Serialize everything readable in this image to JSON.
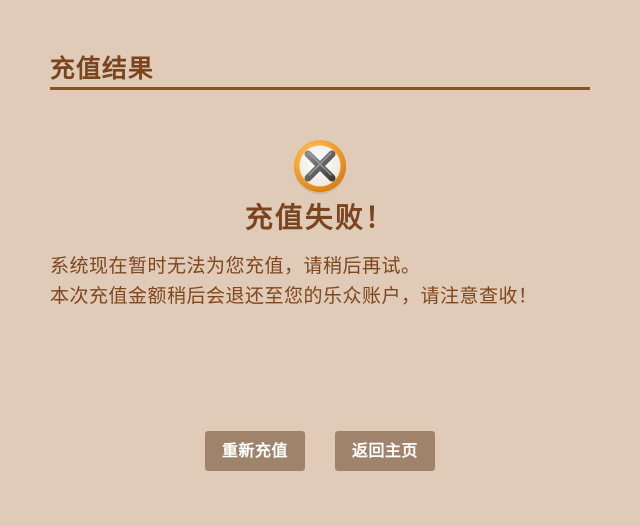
{
  "header": {
    "title": "充值结果"
  },
  "result": {
    "icon": "x-mark-circle-icon",
    "heading": "充值失败！",
    "message_lines": [
      "系统现在暂时无法为您充值，请稍后再试。",
      "本次充值金额稍后会退还至您的乐众账户，请注意查收！"
    ]
  },
  "actions": {
    "retry_label": "重新充值",
    "home_label": "返回主页"
  },
  "colors": {
    "background": "#dfcbb8",
    "text": "#7a451e",
    "button": "#a0836b",
    "icon_ring": "#f0a030"
  }
}
